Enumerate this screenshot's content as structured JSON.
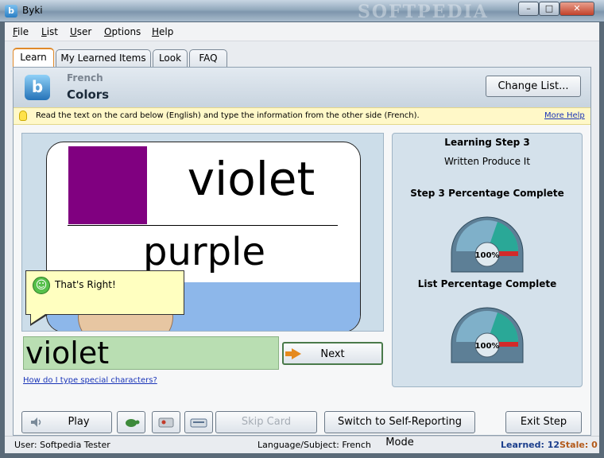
{
  "window": {
    "title": "Byki",
    "app_icon": "b",
    "watermark": "SOFTPEDIA",
    "min_glyph": "–",
    "max_glyph": "□",
    "close_glyph": "✕"
  },
  "menu": [
    "File",
    "List",
    "User",
    "Options",
    "Help"
  ],
  "tabs": [
    {
      "label": "Learn",
      "active": true
    },
    {
      "label": "My Learned Items",
      "active": false
    },
    {
      "label": "Look",
      "active": false
    },
    {
      "label": "FAQ",
      "active": false
    }
  ],
  "header": {
    "logo": "b",
    "language": "French",
    "list_name": "Colors",
    "change_list_label": "Change List..."
  },
  "hint": {
    "text": "Read the text on the card below (English) and type the information from the other side (French).",
    "more_help": "More Help"
  },
  "card": {
    "french_word": "violet",
    "english_word": "purple",
    "swatch_color": "#800080"
  },
  "feedback": {
    "text": "That's Right!",
    "icon": "smile-icon"
  },
  "answer": {
    "value": "violet"
  },
  "next_label": "Next",
  "special_chars_link": "How do I type special characters?",
  "progress": {
    "step_title": "Learning Step 3",
    "step_name": "Written Produce It",
    "step_pct_label": "Step 3 Percentage Complete",
    "step_pct": "100%",
    "list_pct_label": "List Percentage Complete",
    "list_pct": "100%"
  },
  "bottom": {
    "play_label": "Play",
    "skip_label": "Skip Card",
    "switch_label": "Switch to Self-Reporting Mode",
    "exit_label": "Exit Step"
  },
  "status": {
    "user": "User: Softpedia Tester",
    "lang": "Language/Subject: French",
    "learned": "Learned: 12",
    "stale": "Stale: 0"
  }
}
